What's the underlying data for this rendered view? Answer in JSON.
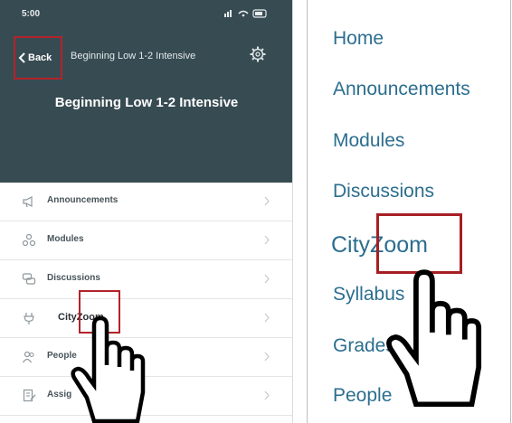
{
  "phone": {
    "status_time": "5:00",
    "back_label": "Back",
    "nav_title": "Beginning Low 1-2 Intensive",
    "course_title": "Beginning Low 1-2 Intensive",
    "rows": [
      {
        "label": "Announcements",
        "icon": "megaphone-icon"
      },
      {
        "label": "Modules",
        "icon": "modules-icon"
      },
      {
        "label": "Discussions",
        "icon": "discussions-icon"
      },
      {
        "label": "CityZoom",
        "icon": "plug-icon"
      },
      {
        "label": "People",
        "icon": "people-icon"
      },
      {
        "label": "Assig",
        "icon": "assignments-icon"
      }
    ]
  },
  "course_nav": {
    "links": [
      "Home",
      "Announcements",
      "Modules",
      "Discussions",
      "CityZoom",
      "Syllabus",
      "Grades",
      "People"
    ]
  },
  "colors": {
    "header_bg": "#374b52",
    "highlight_red": "#b3232a",
    "link_blue": "#2c6e8f"
  },
  "icons": [
    "hand-cursor-icon",
    "gear-icon",
    "back-chevron-icon",
    "chevron-right-icon"
  ]
}
